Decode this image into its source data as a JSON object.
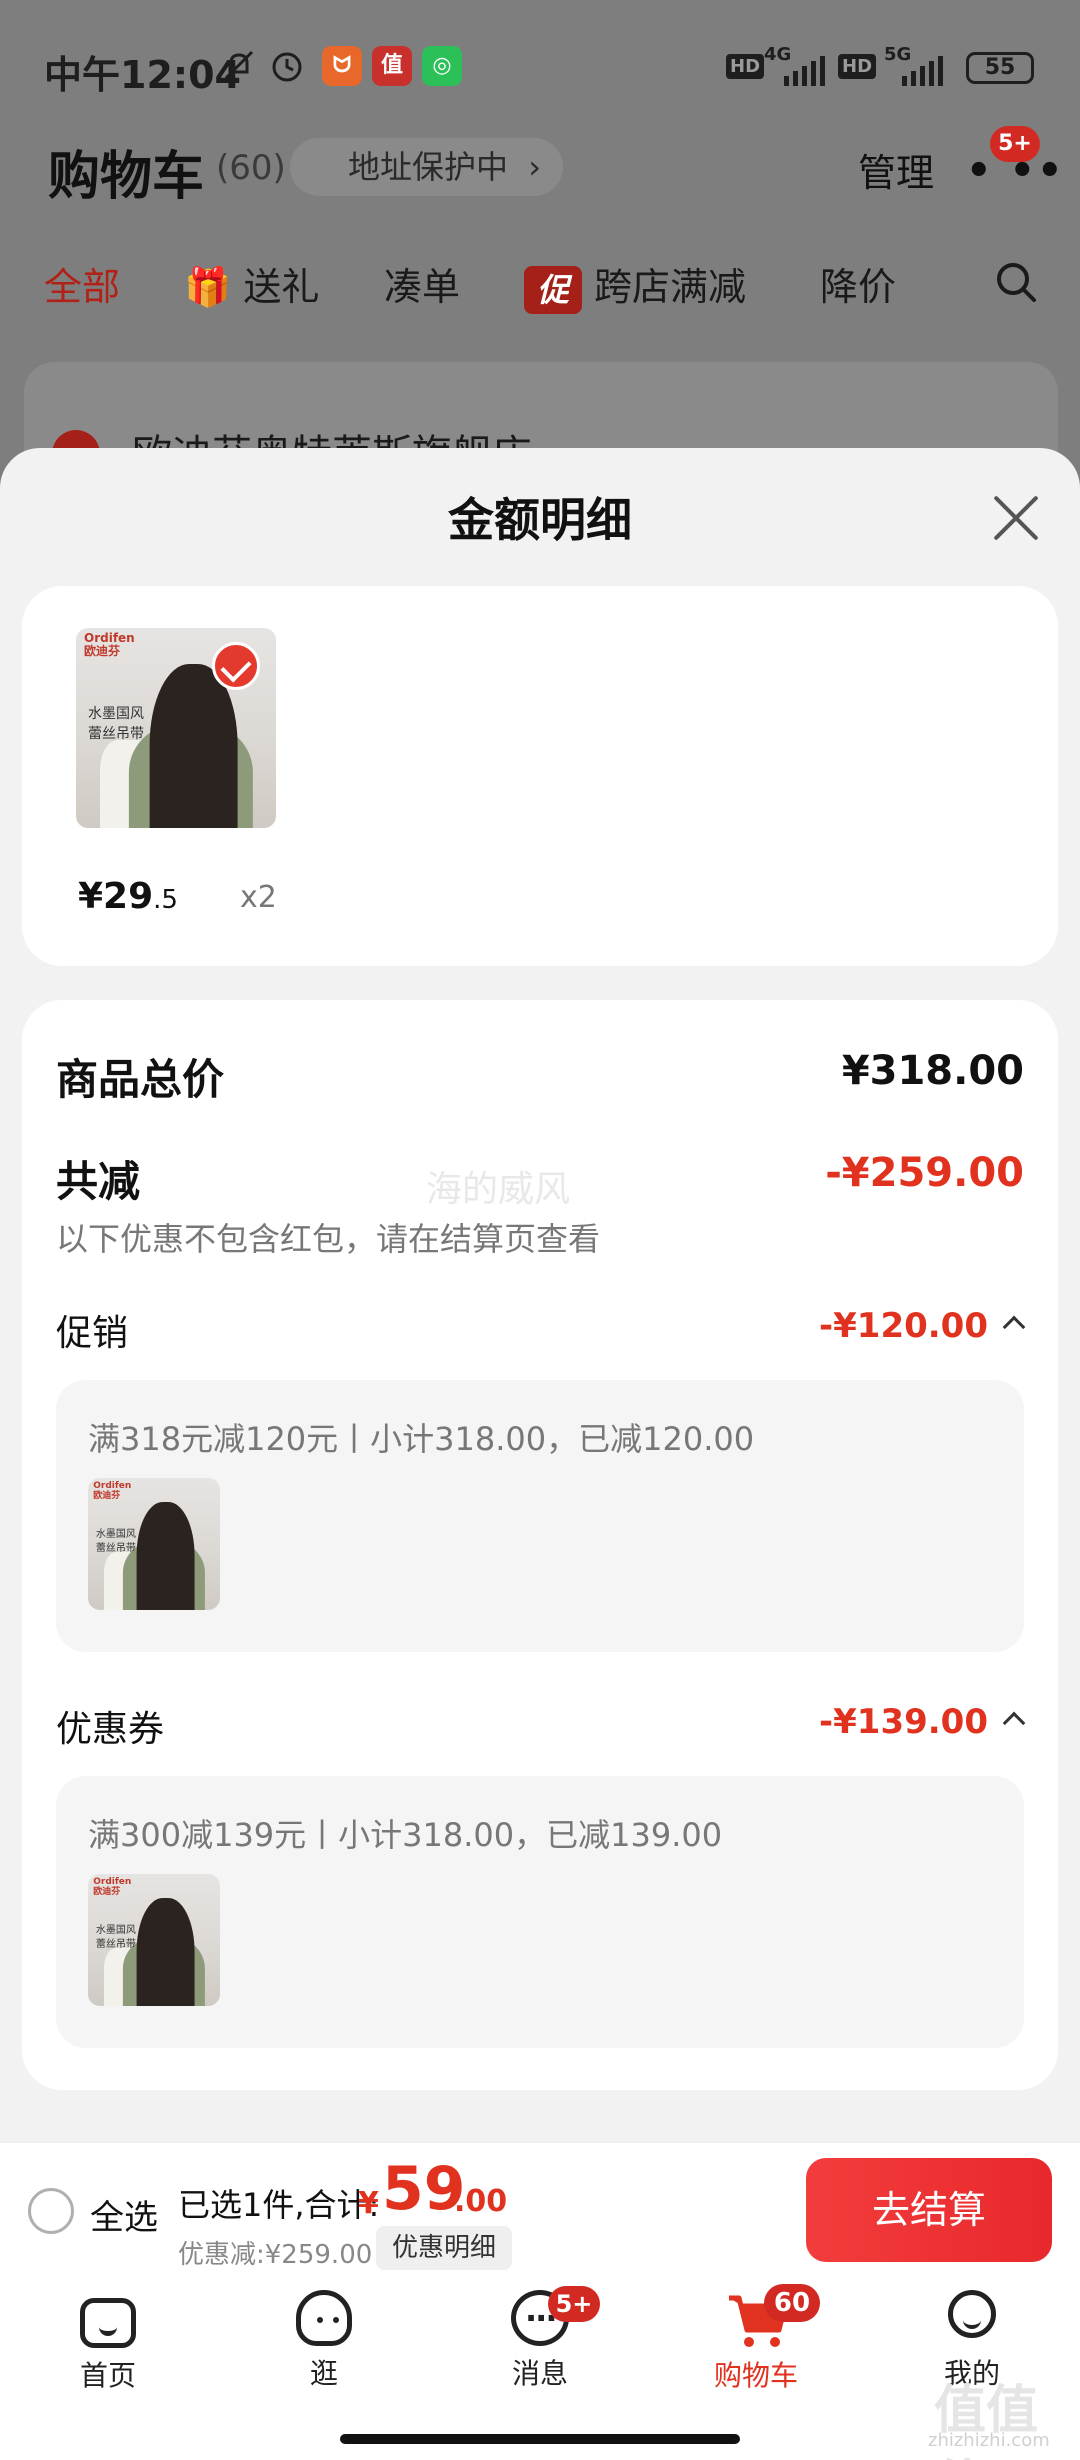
{
  "status_bar": {
    "time": "中午12:04",
    "network_1": "4G",
    "network_2": "5G",
    "hd": "HD",
    "battery": "55",
    "app_icon_2": "值"
  },
  "header": {
    "title": "购物车",
    "count": "(60)",
    "address_protect": "地址保护中",
    "manage": "管理",
    "more_badge": "5+"
  },
  "filter_tabs": {
    "all": "全部",
    "gift": "送礼",
    "combine": "凑单",
    "promo_tag": "促",
    "cross_store": "跨店满减",
    "price_drop": "降价"
  },
  "store": {
    "name": "欧迪芬奥特莱斯旗舰店"
  },
  "sheet": {
    "title": "金额明细",
    "product": {
      "brand": "Ordifen",
      "brand_cn": "欧迪芬",
      "image_text_1": "水墨国风",
      "image_text_2": "蕾丝吊带",
      "price_yen": "¥29",
      "price_dec": ".5",
      "qty": "x2"
    },
    "total_label": "商品总价",
    "total_value": "¥318.00",
    "discount_label": "共减",
    "discount_value": "-¥259.00",
    "note": "以下优惠不包含红包，请在结算页查看",
    "watermark": "海的威风",
    "promotion": {
      "label": "促销",
      "value": "-¥120.00",
      "rule": "满318元减120元丨小计318.00，已减120.00"
    },
    "coupon": {
      "label": "优惠券",
      "value": "-¥139.00",
      "rule": "满300减139元丨小计318.00，已减139.00"
    }
  },
  "bottom_bar": {
    "select_all": "全选",
    "selected_summary": "已选1件,合计:",
    "yen": "¥",
    "total_int": "59",
    "total_dec": ".00",
    "saved": "优惠减:¥259.00",
    "detail_button": "优惠明细",
    "checkout": "去结算"
  },
  "nav": {
    "home": "首页",
    "browse": "逛",
    "messages": "消息",
    "messages_badge": "5+",
    "cart": "购物车",
    "cart_badge": "60",
    "me": "我的"
  },
  "corner_watermark": "值值值",
  "corner_watermark_url": "zhizhizhi.com",
  "colors": {
    "accent_red": "#e0321f",
    "overlay_gray": "#7e7e7e",
    "sheet_bg": "#f2f2f2"
  }
}
